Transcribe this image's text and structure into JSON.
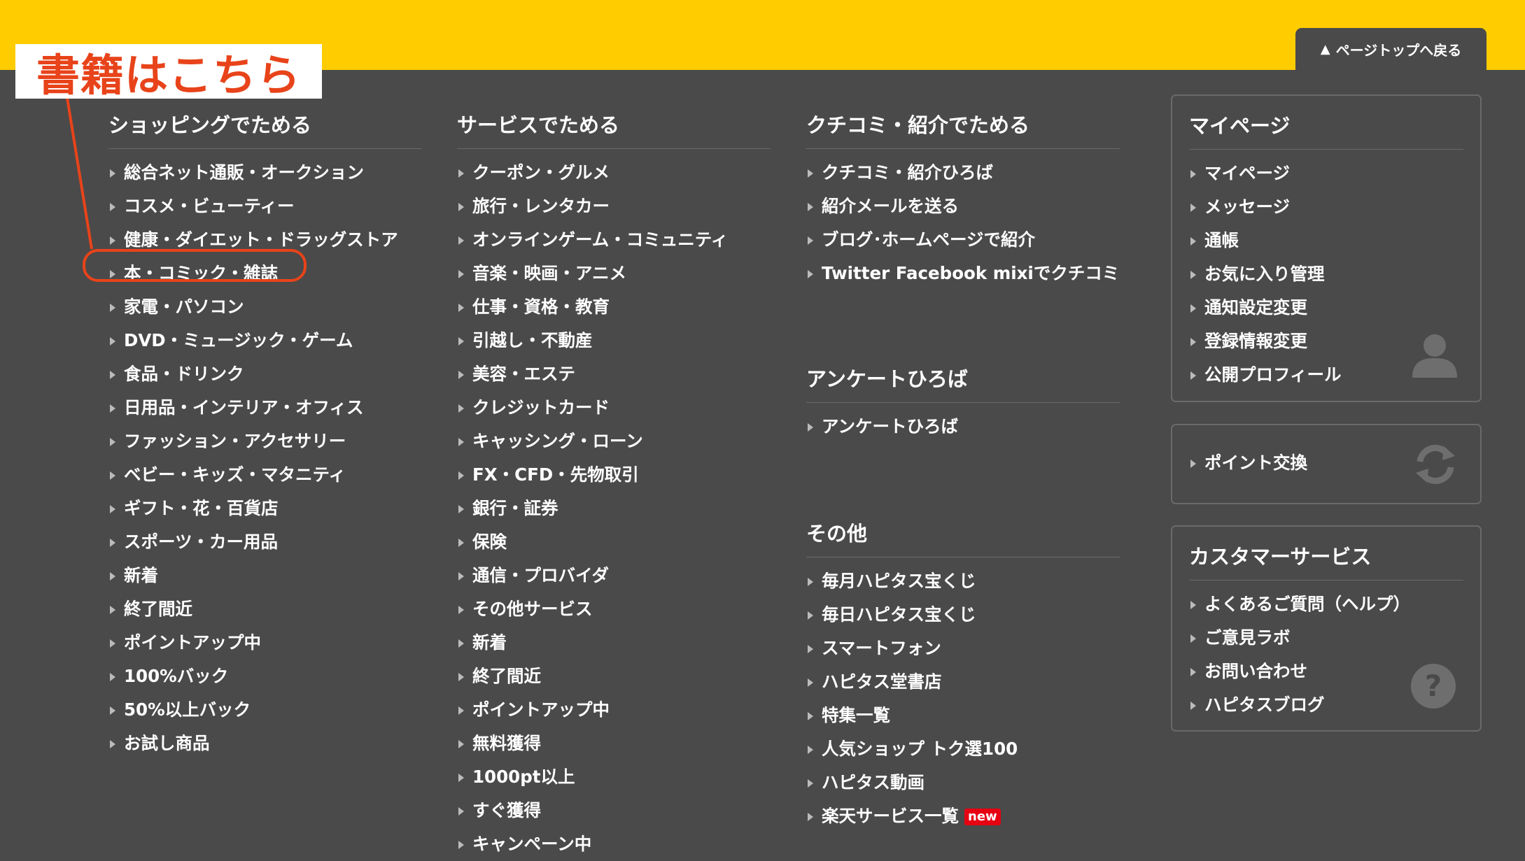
{
  "header": {
    "pagetop_label": "ページトップへ戻る",
    "pagetop_icon": "up-triangle-icon"
  },
  "annotation": {
    "label": "書籍はこちら",
    "color": "#e8431a"
  },
  "shopping": {
    "title": "ショッピングでためる",
    "items": [
      "総合ネット通販・オークション",
      "コスメ・ビューティー",
      "健康・ダイエット・ドラッグストア",
      "本・コミック・雑誌",
      "家電・パソコン",
      "DVD・ミュージック・ゲーム",
      "食品・ドリンク",
      "日用品・インテリア・オフィス",
      "ファッション・アクセサリー",
      "ベビー・キッズ・マタニティ",
      "ギフト・花・百貨店",
      "スポーツ・カー用品",
      "新着",
      "終了間近",
      "ポイントアップ中",
      "100%バック",
      "50%以上バック",
      "お試し商品"
    ]
  },
  "service": {
    "title": "サービスでためる",
    "items": [
      "クーポン・グルメ",
      "旅行・レンタカー",
      "オンラインゲーム・コミュニティ",
      "音楽・映画・アニメ",
      "仕事・資格・教育",
      "引越し・不動産",
      "美容・エステ",
      "クレジットカード",
      "キャッシング・ローン",
      "FX・CFD・先物取引",
      "銀行・証券",
      "保険",
      "通信・プロバイダ",
      "その他サービス",
      "新着",
      "終了間近",
      "ポイントアップ中",
      "無料獲得",
      "1000pt以上",
      "すぐ獲得",
      "キャンペーン中"
    ]
  },
  "kuchikomi": {
    "title": "クチコミ・紹介でためる",
    "items": [
      "クチコミ・紹介ひろば",
      "紹介メールを送る",
      "ブログ･ホームページで紹介",
      "Twitter Facebook mixiでクチコミ"
    ]
  },
  "survey": {
    "title": "アンケートひろば",
    "items": [
      "アンケートひろば"
    ]
  },
  "other": {
    "title": "その他",
    "items": [
      "毎月ハピタス宝くじ",
      "毎日ハピタス宝くじ",
      "スマートフォン",
      "ハピタス堂書店",
      "特集一覧",
      "人気ショップ トク選100",
      "ハピタス動画",
      "楽天サービス一覧"
    ],
    "new_badge": "new"
  },
  "mypage": {
    "title": "マイページ",
    "items": [
      "マイページ",
      "メッセージ",
      "通帳",
      "お気に入り管理",
      "通知設定変更",
      "登録情報変更",
      "公開プロフィール"
    ],
    "icon": "user-silhouette-icon"
  },
  "points": {
    "items": [
      "ポイント交換"
    ],
    "icon": "refresh-arrows-icon"
  },
  "customer": {
    "title": "カスタマーサービス",
    "items": [
      "よくあるご質問（ヘルプ）",
      "ご意見ラボ",
      "お問い合わせ",
      "ハピタスブログ"
    ],
    "icon": "question-mark-icon"
  },
  "colors": {
    "header_yellow": "#ffcc00",
    "background": "#4a4a4a",
    "badge_red": "#e60012"
  }
}
